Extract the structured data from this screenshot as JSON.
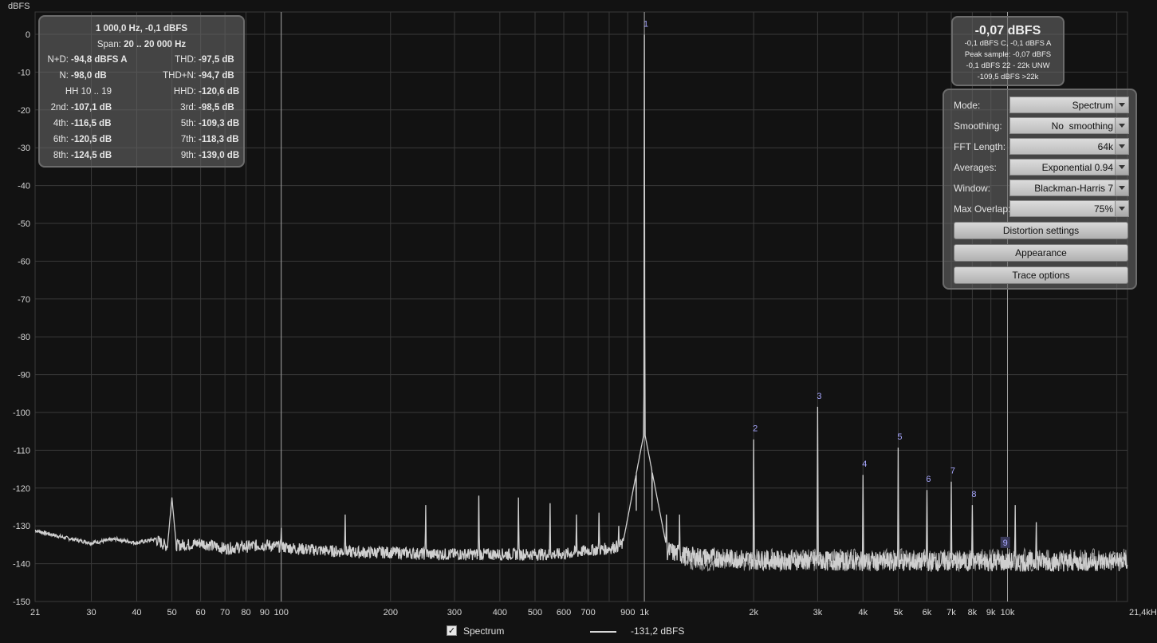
{
  "y_unit": "dBFS",
  "distortion_panel": {
    "header1": "1 000,0 Hz, -0,1 dBFS",
    "span_label": "Span:",
    "span_value": "20 .. 20 000 Hz",
    "rows": [
      {
        "l_label": "N+D:",
        "l_value": "-94,8 dBFS A",
        "r_label": "THD:",
        "r_value": "-97,5 dB"
      },
      {
        "l_label": "N:",
        "l_value": "-98,0 dB",
        "r_label": "THD+N:",
        "r_value": "-94,7 dB"
      },
      {
        "l_label": "HH 10 .. 19",
        "l_value": "",
        "r_label": "HHD:",
        "r_value": "-120,6 dB"
      },
      {
        "l_label": "2nd:",
        "l_value": "-107,1 dB",
        "r_label": "3rd:",
        "r_value": "-98,5 dB"
      },
      {
        "l_label": "4th:",
        "l_value": "-116,5 dB",
        "r_label": "5th:",
        "r_value": "-109,3 dB"
      },
      {
        "l_label": "6th:",
        "l_value": "-120,5 dB",
        "r_label": "7th:",
        "r_value": "-118,3 dB"
      },
      {
        "l_label": "8th:",
        "l_value": "-124,5 dB",
        "r_label": "9th:",
        "r_value": "-139,0 dB"
      }
    ]
  },
  "level_panel": {
    "main": "-0,07 dBFS",
    "line1": "-0,1 dBFS C, -0,1 dBFS A",
    "line2": "Peak sample: -0,07 dBFS",
    "line3": "-0,1 dBFS 22 - 22k UNW",
    "line4": "-109,5 dBFS >22k"
  },
  "settings": {
    "rows": [
      {
        "label": "Mode:",
        "value": "Spectrum"
      },
      {
        "label": "Smoothing:",
        "value": "No  smoothing"
      },
      {
        "label": "FFT Length:",
        "value": "64k"
      },
      {
        "label": "Averages:",
        "value": "Exponential 0.94"
      },
      {
        "label": "Window:",
        "value": "Blackman-Harris 7"
      },
      {
        "label": "Max Overlap:",
        "value": "75%"
      }
    ],
    "buttons": [
      "Distortion settings",
      "Appearance",
      "Trace options"
    ]
  },
  "legend": {
    "checked": "✓",
    "series_name": "Spectrum",
    "cursor_value": "-131,2 dBFS"
  },
  "colors": {
    "background": "#121212",
    "grid": "#3a3a3a",
    "trace": "#cfcfcf",
    "harmonic_label": "#a8a8ff",
    "marker_line": "#bdbdbd"
  },
  "chart_data": {
    "type": "line",
    "x_scale": "log",
    "xlim": [
      21,
      21400
    ],
    "ylim": [
      -150,
      0
    ],
    "grid": true,
    "y_ticks": [
      0,
      -10,
      -20,
      -30,
      -40,
      -50,
      -60,
      -70,
      -80,
      -90,
      -100,
      -110,
      -120,
      -130,
      -140,
      -150
    ],
    "x_ticks": [
      {
        "v": 21,
        "t": "21"
      },
      {
        "v": 30,
        "t": "30"
      },
      {
        "v": 40,
        "t": "40"
      },
      {
        "v": 50,
        "t": "50"
      },
      {
        "v": 60,
        "t": "60"
      },
      {
        "v": 70,
        "t": "70"
      },
      {
        "v": 80,
        "t": "80"
      },
      {
        "v": 90,
        "t": "90"
      },
      {
        "v": 100,
        "t": "100"
      },
      {
        "v": 200,
        "t": "200"
      },
      {
        "v": 300,
        "t": "300"
      },
      {
        "v": 400,
        "t": "400"
      },
      {
        "v": 500,
        "t": "500"
      },
      {
        "v": 600,
        "t": "600"
      },
      {
        "v": 700,
        "t": "700"
      },
      {
        "v": 900,
        "t": "900"
      },
      {
        "v": 1000,
        "t": "1k"
      },
      {
        "v": 2000,
        "t": "2k"
      },
      {
        "v": 3000,
        "t": "3k"
      },
      {
        "v": 4000,
        "t": "4k"
      },
      {
        "v": 5000,
        "t": "5k"
      },
      {
        "v": 6000,
        "t": "6k"
      },
      {
        "v": 7000,
        "t": "7k"
      },
      {
        "v": 8000,
        "t": "8k"
      },
      {
        "v": 9000,
        "t": "9k"
      },
      {
        "v": 10000,
        "t": "10k"
      },
      {
        "v": 21400,
        "t": "21,4kHz"
      }
    ],
    "vertical_markers": [
      100,
      1000,
      10000
    ],
    "harmonics": [
      {
        "n": "1",
        "f": 1000,
        "db": -0.1
      },
      {
        "n": "2",
        "f": 2000,
        "db": -107.1
      },
      {
        "n": "3",
        "f": 3000,
        "db": -98.5
      },
      {
        "n": "4",
        "f": 4000,
        "db": -116.5
      },
      {
        "n": "5",
        "f": 5000,
        "db": -109.3
      },
      {
        "n": "6",
        "f": 6000,
        "db": -120.5
      },
      {
        "n": "7",
        "f": 7000,
        "db": -118.3
      },
      {
        "n": "8",
        "f": 8000,
        "db": -124.5
      },
      {
        "n": "9",
        "f": 9000,
        "db": -139.0
      }
    ],
    "spurs": [
      {
        "f": 50,
        "db": -122.5
      },
      {
        "f": 100,
        "db": -130.5
      },
      {
        "f": 150,
        "db": -127
      },
      {
        "f": 250,
        "db": -124.5
      },
      {
        "f": 350,
        "db": -122
      },
      {
        "f": 450,
        "db": -122.5
      },
      {
        "f": 550,
        "db": -124
      },
      {
        "f": 650,
        "db": -127
      },
      {
        "f": 750,
        "db": -126.5
      },
      {
        "f": 850,
        "db": -130
      },
      {
        "f": 950,
        "db": -126
      },
      {
        "f": 1050,
        "db": -126
      },
      {
        "f": 1150,
        "db": -127
      },
      {
        "f": 1250,
        "db": -127
      },
      {
        "f": 10500,
        "db": -124.5
      },
      {
        "f": 12000,
        "db": -129
      }
    ],
    "noise_points": [
      [
        21,
        -131.2
      ],
      [
        25,
        -133
      ],
      [
        30,
        -134.5
      ],
      [
        35,
        -133.5
      ],
      [
        40,
        -134.5
      ],
      [
        45,
        -133.5
      ],
      [
        48,
        -135.2
      ],
      [
        55,
        -135
      ],
      [
        60,
        -134.5
      ],
      [
        70,
        -136
      ],
      [
        80,
        -135.5
      ],
      [
        90,
        -135
      ],
      [
        110,
        -136
      ],
      [
        130,
        -136.5
      ],
      [
        160,
        -137
      ],
      [
        200,
        -137
      ],
      [
        260,
        -137.5
      ],
      [
        330,
        -137.5
      ],
      [
        400,
        -137.5
      ],
      [
        500,
        -137.5
      ],
      [
        600,
        -137.5
      ],
      [
        700,
        -136.5
      ],
      [
        800,
        -136
      ],
      [
        900,
        -134.5
      ],
      [
        960,
        -132
      ],
      [
        1100,
        -136
      ],
      [
        1300,
        -138
      ],
      [
        2000,
        -139
      ],
      [
        5000,
        -139.5
      ],
      [
        10000,
        -139.5
      ],
      [
        21400,
        -139.5
      ]
    ]
  }
}
